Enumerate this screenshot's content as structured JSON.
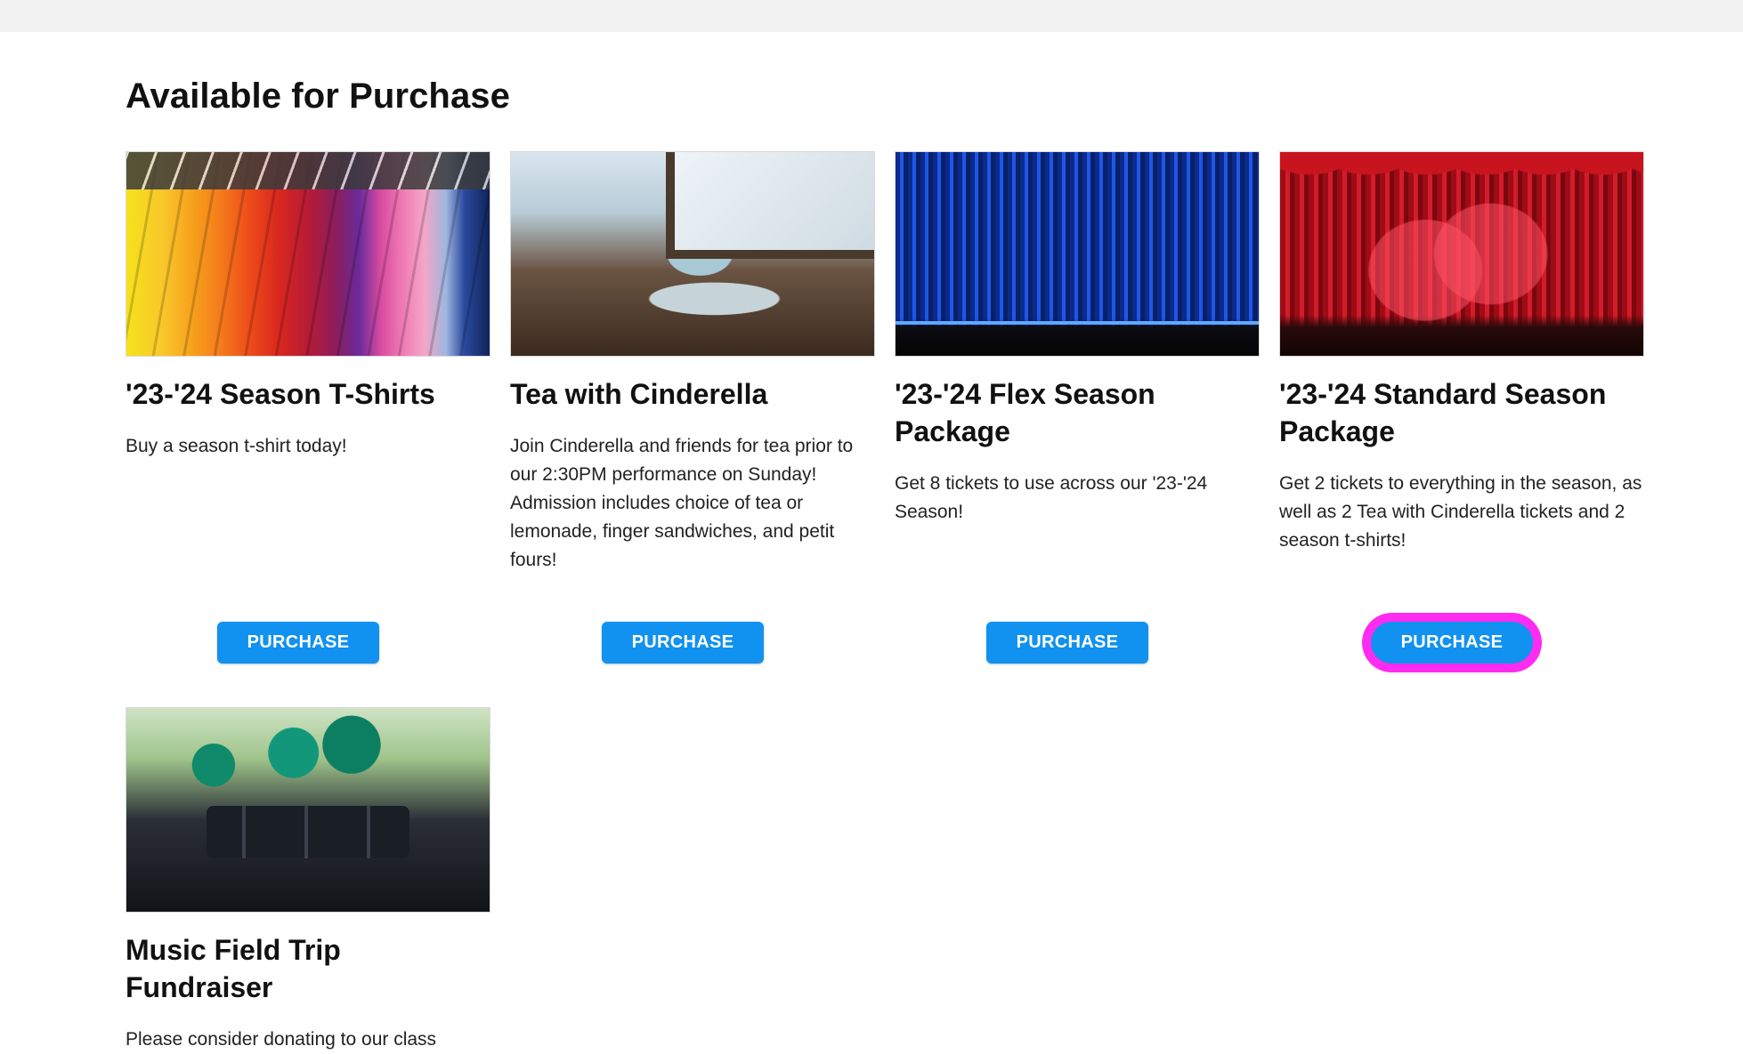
{
  "page": {
    "title": "Available for Purchase"
  },
  "products": [
    {
      "title": "'23-'24 Season T-Shirts",
      "description": "Buy a season t-shirt today!",
      "button_label": "PURCHASE",
      "image_icon": "tshirts-image"
    },
    {
      "title": "Tea with Cinderella",
      "description": "Join Cinderella and friends for tea prior to our 2:30PM performance on Sunday! Admission includes choice of tea or lemonade, finger sandwiches, and petit fours!",
      "button_label": "PURCHASE",
      "image_icon": "tea-cup-image"
    },
    {
      "title": "'23-'24 Flex Season Package",
      "description": "Get 8 tickets to use across our '23-'24 Season!",
      "button_label": "PURCHASE",
      "image_icon": "blue-curtain-image"
    },
    {
      "title": "'23-'24 Standard Season Package",
      "description": "Get 2 tickets to everything in the season, as well as 2 Tea with Cinderella tickets and 2 season t-shirts!",
      "button_label": "PURCHASE",
      "image_icon": "red-curtain-image"
    },
    {
      "title": "Music Field Trip Fundraiser",
      "description": "Please consider donating to our class",
      "image_icon": "marching-band-image"
    }
  ],
  "colors": {
    "button": "#1191f0",
    "focus_ring": "#ff2bf0",
    "top_bar": "#f2f2f2"
  }
}
